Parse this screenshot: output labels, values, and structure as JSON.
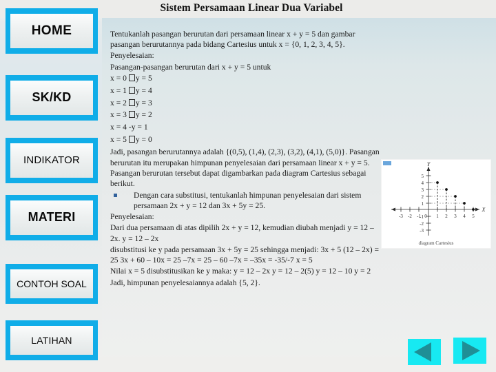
{
  "slide": {
    "title": "Sistem Persamaan Linear Dua Variabel"
  },
  "sidebar": {
    "items": [
      {
        "id": "home",
        "label": "HOME"
      },
      {
        "id": "skkd",
        "label": "SK/KD"
      },
      {
        "id": "indikator",
        "label": "INDIKATOR"
      },
      {
        "id": "materi",
        "label": "MATERI"
      },
      {
        "id": "contoh",
        "label": "CONTOH SOAL"
      },
      {
        "id": "latihan",
        "label": "LATIHAN"
      }
    ]
  },
  "content": {
    "intro": "Tentukanlah pasangan berurutan dari persamaan linear x + y = 5 dan gambar pasangan berurutannya pada bidang Cartesius untuk x = {0, 1, 2, 3, 4, 5}.",
    "penyelesaian_label_1": "Penyelesaian:",
    "pasangan_line": "Pasangan-pasangan berurutan dari x + y = 5 untuk",
    "equations": [
      {
        "left": "x = 0",
        "right": "y = 5"
      },
      {
        "left": "x = 1",
        "right": "y = 4"
      },
      {
        "left": "x = 2",
        "right": "y = 3"
      },
      {
        "left": "x = 3",
        "right": "y = 2"
      },
      {
        "left": "x = 4",
        "right": "y = 1",
        "plain": true
      },
      {
        "left": "x = 5",
        "right": "y = 0"
      }
    ],
    "jadi_pasangan": "Jadi, pasangan berurutannya adalah {(0,5), (1,4), (2,3), (3,2), (4,1), (5,0)}. Pasangan",
    "himpunan_par": "berurutan itu merupakan himpunan penyelesaian dari persamaan linear x + y = 5. Pasangan berurutan tersebut dapat digambarkan pada diagram Cartesius sebagai berikut.",
    "bullet": "Dengan cara substitusi, tentukanlah himpunan penyelesaian dari sistem persamaan 2x + y = 12 dan 3x + 5y = 25.",
    "penyelesaian_label_2": "Penyelesaian:",
    "par_dari_dua": "Dari dua persamaan di atas dipilih 2x + y = 12, kemudian diubah menjadi y = 12 – 2x. y = 12 – 2x",
    "par_disubstitusi": "disubstitusi ke y pada persamaan 3x + 5y = 25 sehingga menjadi: 3x + 5 (12 – 2x) = 25 3x + 60 – 10x = 25 –7x = 25 – 60 –7x = –35x =  -35/-7 x = 5",
    "par_nilai_x": "Nilai x = 5 disubstitusikan ke y maka: y = 12 – 2x y = 12 – 2(5) y = 12 – 10 y = 2",
    "par_jadi": "Jadi, himpunan penyelesaiannya adalah {5, 2}."
  },
  "figure": {
    "caption": "diagram Cartesius",
    "x_axis_label": "X",
    "y_axis_label": "Y",
    "x_ticks": [
      "-3",
      "-2",
      "-1",
      "0",
      "1",
      "2",
      "3",
      "4",
      "5"
    ],
    "y_ticks": [
      "5",
      "4",
      "3",
      "2",
      "1",
      "-1",
      "-2",
      "-3"
    ],
    "points": [
      {
        "x": 1,
        "y": 4
      },
      {
        "x": 2,
        "y": 3
      },
      {
        "x": 3,
        "y": 2
      },
      {
        "x": 4,
        "y": 1
      },
      {
        "x": 5,
        "y": 0
      }
    ]
  },
  "nav": {
    "prev_label": "previous-slide",
    "next_label": "next-slide"
  },
  "colors": {
    "nav_blue": "#10ade8",
    "arrow_cyan": "#17e9f2",
    "arrow_teal": "#1f8f96",
    "bullet_blue": "#31619b"
  }
}
